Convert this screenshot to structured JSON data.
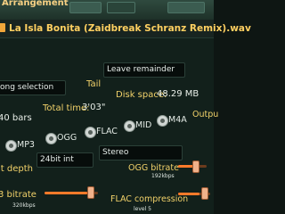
{
  "window": {
    "title": "Arrangement"
  },
  "header": {
    "file_title": "La Isla Bonita (Zaidbreak Schranz Remix).wav"
  },
  "selection": {
    "value": "ong selection"
  },
  "tail": {
    "label": "Tail",
    "value": "Leave remainder"
  },
  "info": {
    "bars": "40 bars",
    "total_time_label": "Total time:",
    "total_time_value": "3'03\"",
    "disk_space_label": "Disk space:",
    "disk_space_value": "48.29 MB"
  },
  "formats": {
    "options": [
      {
        "label": "MP3",
        "icon": "radio-icon"
      },
      {
        "label": "OGG",
        "icon": "radio-icon"
      },
      {
        "label": "FLAC",
        "icon": "radio-icon"
      },
      {
        "label": "MID",
        "icon": "radio-icon"
      },
      {
        "label": "M4A",
        "icon": "radio-icon"
      }
    ],
    "output_label": "Outpu"
  },
  "bit_depth": {
    "label": "it depth",
    "value": "24bit int"
  },
  "channels": {
    "value": "Stereo"
  },
  "ogg_bitrate": {
    "label": "OGG bitrate",
    "value": "192kbps",
    "level": 0.55
  },
  "mp3_bitrate": {
    "label": "3 bitrate",
    "value": "320kbps",
    "level": 0.8
  },
  "flac_compression": {
    "label": "FLAC compression",
    "value": "level 5",
    "level": 0.6
  }
}
